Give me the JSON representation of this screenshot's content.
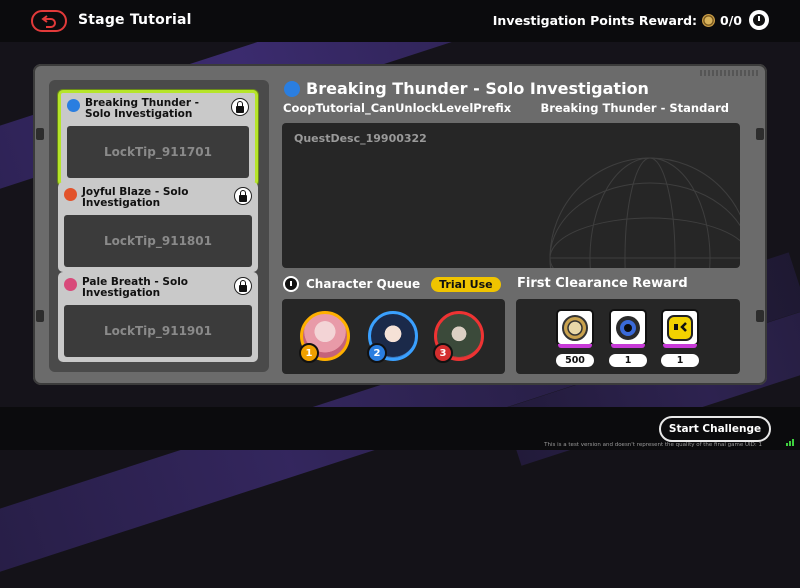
{
  "header": {
    "title": "Stage Tutorial",
    "points_label": "Investigation Points Reward:",
    "points_value": "0/0"
  },
  "stages": [
    {
      "name": "Breaking Thunder - Solo Investigation",
      "lock_tip": "LockTip_911701",
      "color": "#2a7ee0",
      "selected": true
    },
    {
      "name": "Joyful Blaze - Solo Investigation",
      "lock_tip": "LockTip_911801",
      "color": "#e2522a",
      "selected": false
    },
    {
      "name": "Pale Breath - Solo Investigation",
      "lock_tip": "LockTip_911901",
      "color": "#d84a7a",
      "selected": false
    }
  ],
  "detail": {
    "title": "Breaking Thunder - Solo Investigation",
    "prefix": "CoopTutorial_CanUnlockLevelPrefix",
    "mode": "Breaking Thunder - Standard",
    "description": "QuestDesc_19900322"
  },
  "queue": {
    "label": "Character Queue",
    "trial_label": "Trial Use",
    "slots": [
      "1",
      "2",
      "3"
    ]
  },
  "reward": {
    "title": "First Clearance Reward",
    "items": [
      {
        "icon": "coin-reward-icon",
        "count": "500"
      },
      {
        "icon": "camera-reward-icon",
        "count": "1"
      },
      {
        "icon": "face-reward-icon",
        "count": "1"
      }
    ]
  },
  "footer": {
    "start_label": "Start Challenge",
    "disclaimer": "This is a test version and doesn't represent the quality of the final game",
    "uid_label": "UID: 1"
  }
}
